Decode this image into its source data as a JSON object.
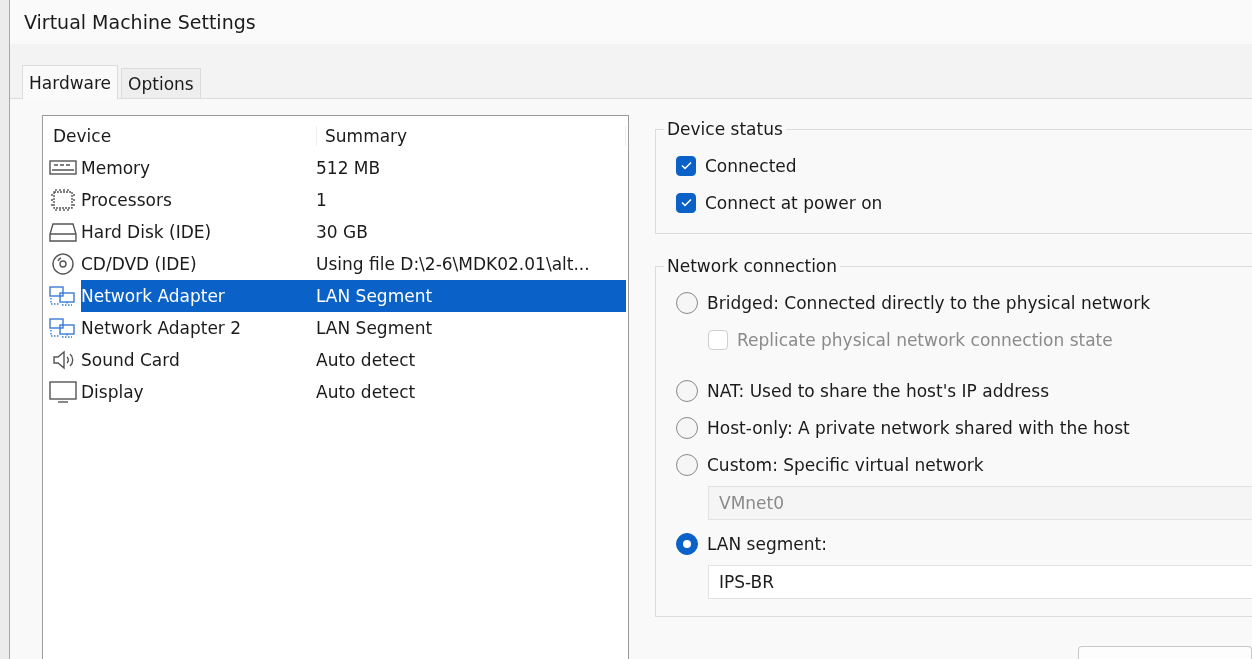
{
  "window": {
    "title": "Virtual Machine Settings"
  },
  "tabs": [
    {
      "label": "Hardware",
      "selected": true
    },
    {
      "label": "Options",
      "selected": false
    }
  ],
  "device_table": {
    "columns": [
      "Device",
      "Summary"
    ],
    "rows": [
      {
        "kind": "memory",
        "device": "Memory",
        "summary": "512 MB",
        "selected": false
      },
      {
        "kind": "processor",
        "device": "Processors",
        "summary": "1",
        "selected": false
      },
      {
        "kind": "disk",
        "device": "Hard Disk (IDE)",
        "summary": "30 GB",
        "selected": false
      },
      {
        "kind": "cd",
        "device": "CD/DVD (IDE)",
        "summary": "Using file D:\\2-6\\MDK02.01\\alt...",
        "selected": false
      },
      {
        "kind": "network",
        "device": "Network Adapter",
        "summary": "LAN Segment",
        "selected": true
      },
      {
        "kind": "network",
        "device": "Network Adapter 2",
        "summary": "LAN Segment",
        "selected": false
      },
      {
        "kind": "sound",
        "device": "Sound Card",
        "summary": "Auto detect",
        "selected": false
      },
      {
        "kind": "display",
        "device": "Display",
        "summary": "Auto detect",
        "selected": false
      }
    ]
  },
  "device_status": {
    "title": "Device status",
    "options": [
      {
        "label": "Connected",
        "checked": true
      },
      {
        "label": "Connect at power on",
        "checked": true
      }
    ]
  },
  "network_connection": {
    "title": "Network connection",
    "items": [
      {
        "kind": "radio",
        "label": "Bridged: Connected directly to the physical network",
        "selected": false
      },
      {
        "kind": "checkbox",
        "label": "Replicate physical network connection state",
        "checked": false,
        "disabled": true
      },
      {
        "kind": "radio",
        "label": "NAT: Used to share the host's IP address",
        "selected": false
      },
      {
        "kind": "radio",
        "label": "Host-only: A private network shared with the host",
        "selected": false
      },
      {
        "kind": "radio",
        "label": "Custom: Specific virtual network",
        "selected": false
      },
      {
        "kind": "field",
        "value": "VMnet0",
        "disabled": true
      },
      {
        "kind": "radio",
        "label": "LAN segment:",
        "selected": true
      },
      {
        "kind": "field",
        "value": "IPS-BR",
        "disabled": false
      }
    ]
  }
}
